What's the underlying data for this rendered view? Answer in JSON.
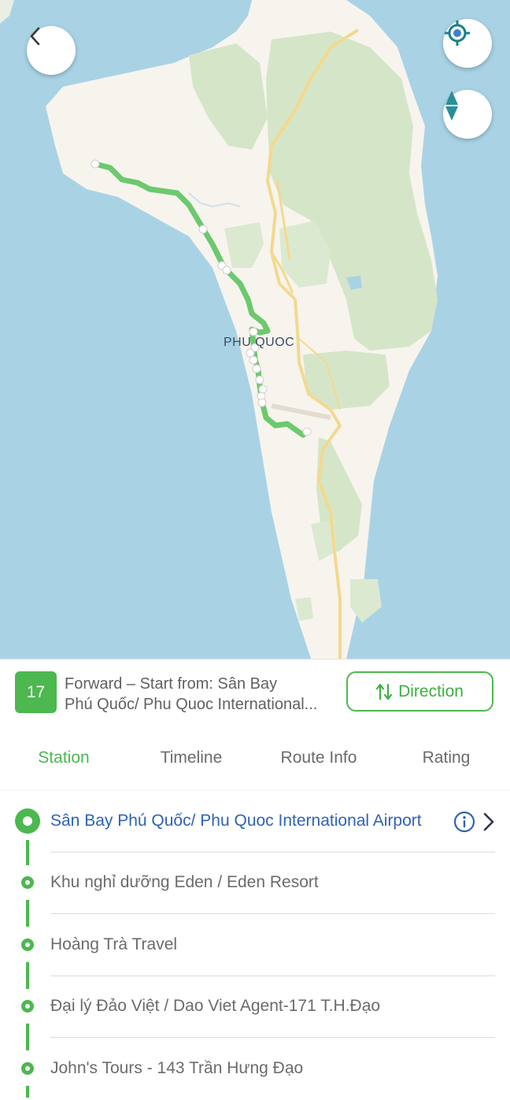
{
  "map": {
    "city_label": "PHU QUOC"
  },
  "route": {
    "number": "17",
    "title_line1": "Forward – Start from: Sân Bay",
    "title_line2": "Phú Quốc/ Phu Quoc International...",
    "direction_label": "Direction"
  },
  "tabs": [
    {
      "label": "Station",
      "active": true
    },
    {
      "label": "Timeline",
      "active": false
    },
    {
      "label": "Route Info",
      "active": false
    },
    {
      "label": "Rating",
      "active": false
    }
  ],
  "stations": [
    {
      "name": "Sân Bay Phú Quốc/ Phu Quoc International Airport"
    },
    {
      "name": "Khu nghỉ dưỡng Eden / Eden Resort"
    },
    {
      "name": "Hoàng Trà Travel"
    },
    {
      "name": "Đại lý Đảo Việt / Dao Viet Agent-171 T.H.Đạo"
    },
    {
      "name": "John's Tours - 143 Trần Hưng Đạo"
    }
  ],
  "colors": {
    "accent_green": "#4cb84f",
    "link_blue": "#2f63b5",
    "water": "#a9d3e5",
    "land": "#f7f4ee",
    "park": "#d5e6c8"
  },
  "icons": {
    "back": "chevron-left-icon",
    "locate": "crosshair-icon",
    "compass": "compass-icon",
    "direction": "swap-vertical-icon",
    "info": "info-icon",
    "more": "chevron-right-icon"
  }
}
